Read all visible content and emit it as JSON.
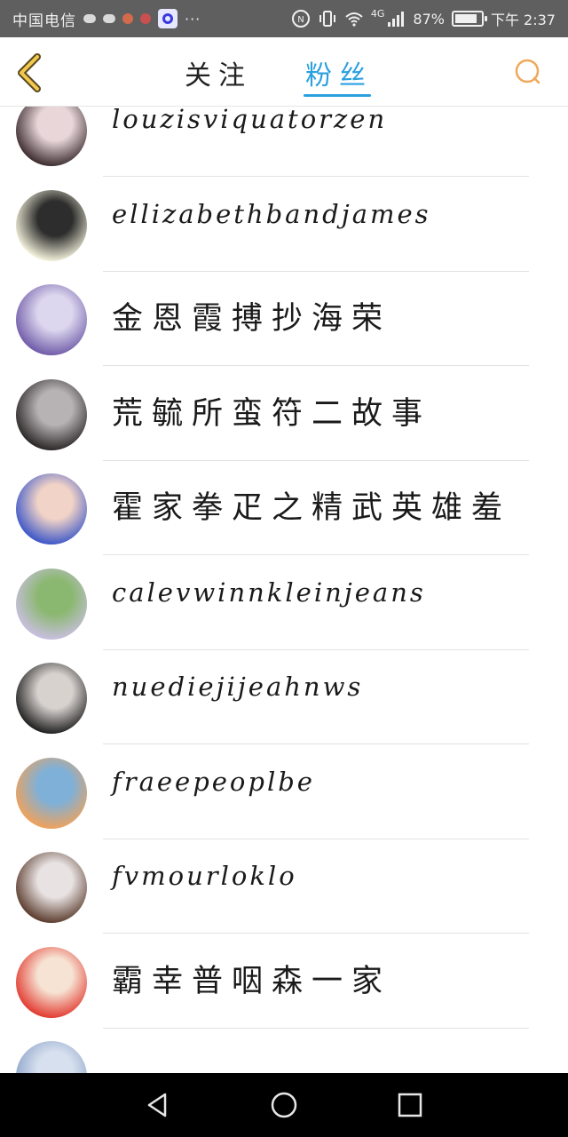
{
  "status_bar": {
    "carrier": "中国电信",
    "more": "···",
    "network": "4G",
    "battery_text": "87%",
    "battery_level": 0.87,
    "time": "下午 2:37"
  },
  "header": {
    "tabs": [
      {
        "label": "关注",
        "active": false
      },
      {
        "label": "粉丝",
        "active": true
      }
    ],
    "accent_color": "#2aa0df",
    "back_icon": "chevron-left-icon",
    "search_icon": "search-icon"
  },
  "fans": [
    {
      "name": "louzisviquatorzen",
      "avatar_colors": [
        "#3b2b2e",
        "#e8d6d9"
      ]
    },
    {
      "name": "ellizabethbandjames",
      "avatar_colors": [
        "#f8f6df",
        "#2d2d2d"
      ]
    },
    {
      "name": "金恩霞搏抄海荣",
      "avatar_colors": [
        "#6f5aa8",
        "#dcd7ee"
      ]
    },
    {
      "name": "荒毓所蛮符二故事",
      "avatar_colors": [
        "#2a2626",
        "#b7b3b5"
      ]
    },
    {
      "name": "霍家拳疋之精武英雄羞",
      "avatar_colors": [
        "#3b56c8",
        "#f1d3c7"
      ]
    },
    {
      "name": "calevwinnkleinjeans",
      "avatar_colors": [
        "#c9bfe0",
        "#8bb870"
      ]
    },
    {
      "name": "nuediejijeahnws",
      "avatar_colors": [
        "#1e1e1e",
        "#d8d2cf"
      ]
    },
    {
      "name": "fraeepeoplbe",
      "avatar_colors": [
        "#f0a25a",
        "#7fb0d8"
      ]
    },
    {
      "name": "fvmourloklo",
      "avatar_colors": [
        "#5a3b2c",
        "#e8e2e2"
      ]
    },
    {
      "name": "霸幸普咽森一家",
      "avatar_colors": [
        "#e2392f",
        "#f6e3d3"
      ]
    },
    {
      "name": "",
      "avatar_colors": [
        "#8aa2c8",
        "#d7e0ee"
      ]
    }
  ],
  "nav": {
    "back_icon": "triangle-back-icon",
    "home_icon": "circle-home-icon",
    "recents_icon": "square-recents-icon"
  }
}
